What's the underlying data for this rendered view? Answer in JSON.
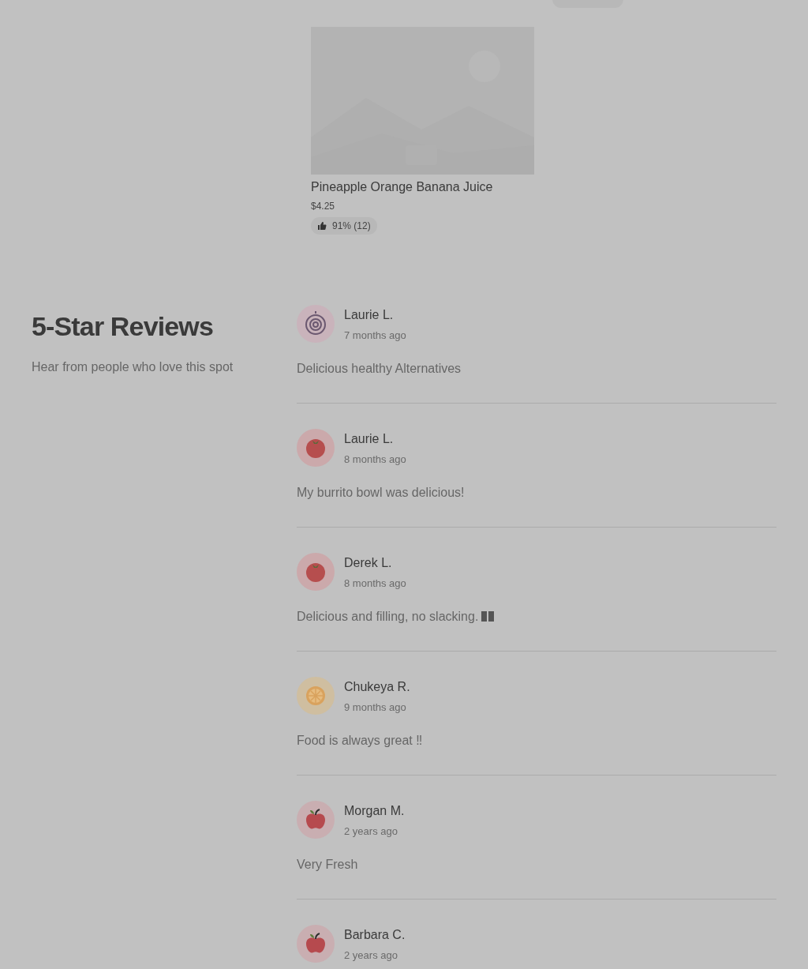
{
  "product": {
    "name": "Pineapple Orange Banana Juice",
    "price": "$4.25",
    "rating": "91% (12)"
  },
  "reviews_section": {
    "title": "5-Star Reviews",
    "subtitle": "Hear from people who love this spot",
    "reviews": [
      {
        "name": "Laurie L.",
        "time": "7 months ago",
        "text": "Delicious healthy Alternatives",
        "kind": "onion"
      },
      {
        "name": "Laurie L.",
        "time": "8 months ago",
        "text": "My burrito bowl was delicious!",
        "kind": "tomato"
      },
      {
        "name": "Derek L.",
        "time": "8 months ago",
        "text": "Delicious and filling, no slacking.",
        "emoji": true,
        "kind": "tomato"
      },
      {
        "name": "Chukeya R.",
        "time": "9 months ago",
        "text": "Food is always great ‼",
        "kind": "orange"
      },
      {
        "name": "Morgan M.",
        "time": "2 years ago",
        "text": "Very Fresh",
        "kind": "apple"
      },
      {
        "name": "Barbara C.",
        "time": "2 years ago",
        "kind": "apple"
      }
    ]
  }
}
